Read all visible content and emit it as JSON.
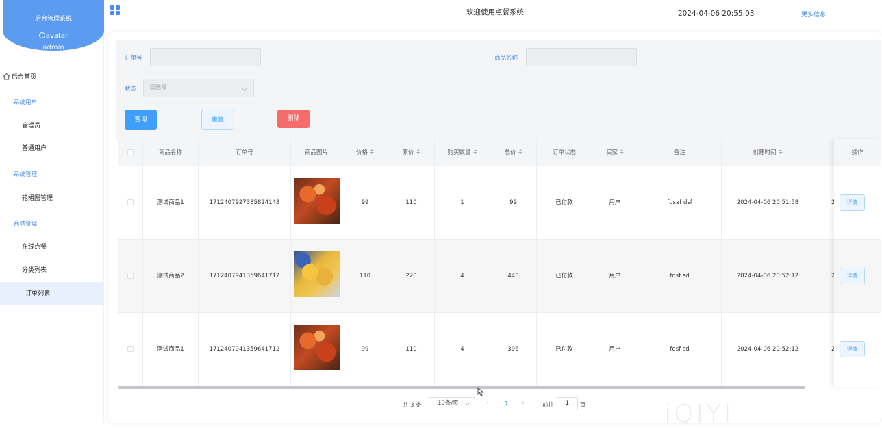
{
  "sidebar": {
    "system_title": "后台管理系统",
    "avatar_alt": "avatar",
    "username": "admin",
    "home": "后台首页",
    "groups": [
      {
        "label": "系统用户",
        "items": [
          "管理员",
          "普通用户"
        ]
      },
      {
        "label": "系统管理",
        "items": [
          "轮播图管理"
        ]
      },
      {
        "label": "商城管理",
        "items": [
          "在线点餐",
          "分类列表",
          "订单列表"
        ]
      }
    ],
    "active_item": "订单列表"
  },
  "header": {
    "welcome": "欢迎使用点餐系统",
    "datetime": "2024-04-06 20:55:03",
    "more": "更多信息"
  },
  "filters": {
    "order_no_label": "订单号",
    "order_no_value": "",
    "product_name_label": "商品名称",
    "product_name_value": "",
    "status_label": "状态",
    "status_placeholder": "请选择"
  },
  "buttons": {
    "search": "查询",
    "reset": "重置",
    "delete": "删除"
  },
  "table": {
    "headers": [
      "商品名称",
      "订单号",
      "商品图片",
      "价格",
      "原价",
      "购买数量",
      "总价",
      "订单状态",
      "买家",
      "备注",
      "创建时间",
      "操作"
    ],
    "rows": [
      {
        "name": "测试商品1",
        "order_no": "1712407927385824148",
        "image": "food-skewers",
        "price": "99",
        "original": "110",
        "qty": "1",
        "total": "99",
        "status": "已付款",
        "buyer": "用户",
        "note": "fdsaf dsf",
        "created": "2024-04-06 20:51:58",
        "extra": "2",
        "action": "详情"
      },
      {
        "name": "测试商品2",
        "order_no": "1712407941359641712",
        "image": "food-dumplings",
        "price": "110",
        "original": "220",
        "qty": "4",
        "total": "440",
        "status": "已付款",
        "buyer": "用户",
        "note": "fdsf sd",
        "created": "2024-04-06 20:52:12",
        "extra": "2",
        "action": "详情"
      },
      {
        "name": "测试商品1",
        "order_no": "1712407941359641712",
        "image": "food-skewers",
        "price": "99",
        "original": "110",
        "qty": "4",
        "total": "396",
        "status": "已付款",
        "buyer": "用户",
        "note": "fdsf sd",
        "created": "2024-04-06 20:52:12",
        "extra": "2",
        "action": "详情"
      }
    ]
  },
  "pagination": {
    "total": "共 3 条",
    "page_size": "10条/页",
    "current_page": "1",
    "goto_label": "前往",
    "goto_value": "1",
    "page_unit": "页"
  },
  "watermark": "iQIYI",
  "colors": {
    "brand": "#5b9bf0",
    "primary": "#409eff",
    "danger": "#f56c6c"
  }
}
